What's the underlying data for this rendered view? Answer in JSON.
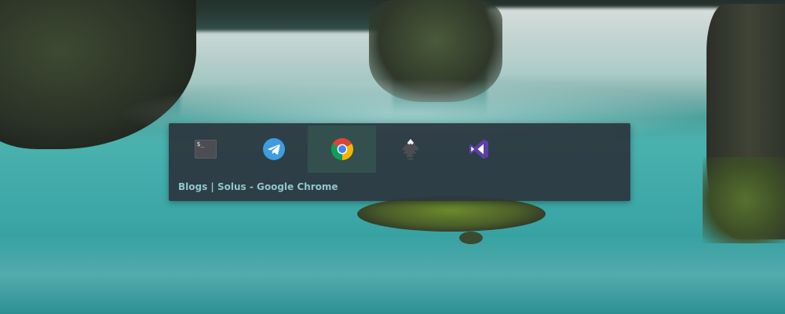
{
  "window_switcher": {
    "apps": [
      {
        "name": "terminal",
        "icon": "terminal-icon",
        "glyph": "$_",
        "active": false
      },
      {
        "name": "telegram",
        "icon": "telegram-icon",
        "active": false
      },
      {
        "name": "google-chrome",
        "icon": "chrome-icon",
        "active": true
      },
      {
        "name": "inkscape",
        "icon": "inkscape-icon",
        "active": false
      },
      {
        "name": "visual-studio-code",
        "icon": "vscode-icon",
        "active": false
      }
    ],
    "selected_window_title": "Blogs | Solus - Google Chrome"
  },
  "colors": {
    "panel_bg": "#2c363e",
    "active_slot": "#33504e",
    "title_text": "#8fc6c9",
    "telegram_blue": "#3d9de0",
    "vscode_purple": "#5b3fa8"
  }
}
